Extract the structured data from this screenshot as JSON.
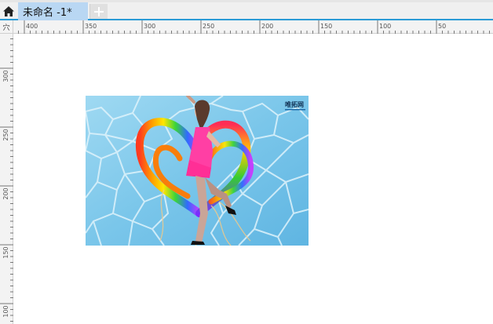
{
  "tabs": [
    {
      "label": "未命名 -1*",
      "active": true
    }
  ],
  "toolbar": {
    "home_icon": "home-icon",
    "new_tab_icon": "plus-icon"
  },
  "ruler": {
    "corner_label": "穴",
    "horizontal_labels": [
      "400",
      "350",
      "300",
      "250",
      "200",
      "150",
      "100",
      "50"
    ],
    "vertical_labels": [
      "300",
      "250",
      "200",
      "150",
      "100"
    ]
  },
  "image": {
    "watermark": "唯拓网"
  },
  "colors": {
    "accent": "#2b9bd6",
    "tab_active": "#b9d7f3",
    "ruler_bg": "#f3f3f3",
    "photo_bg": "#7cc8ea"
  }
}
